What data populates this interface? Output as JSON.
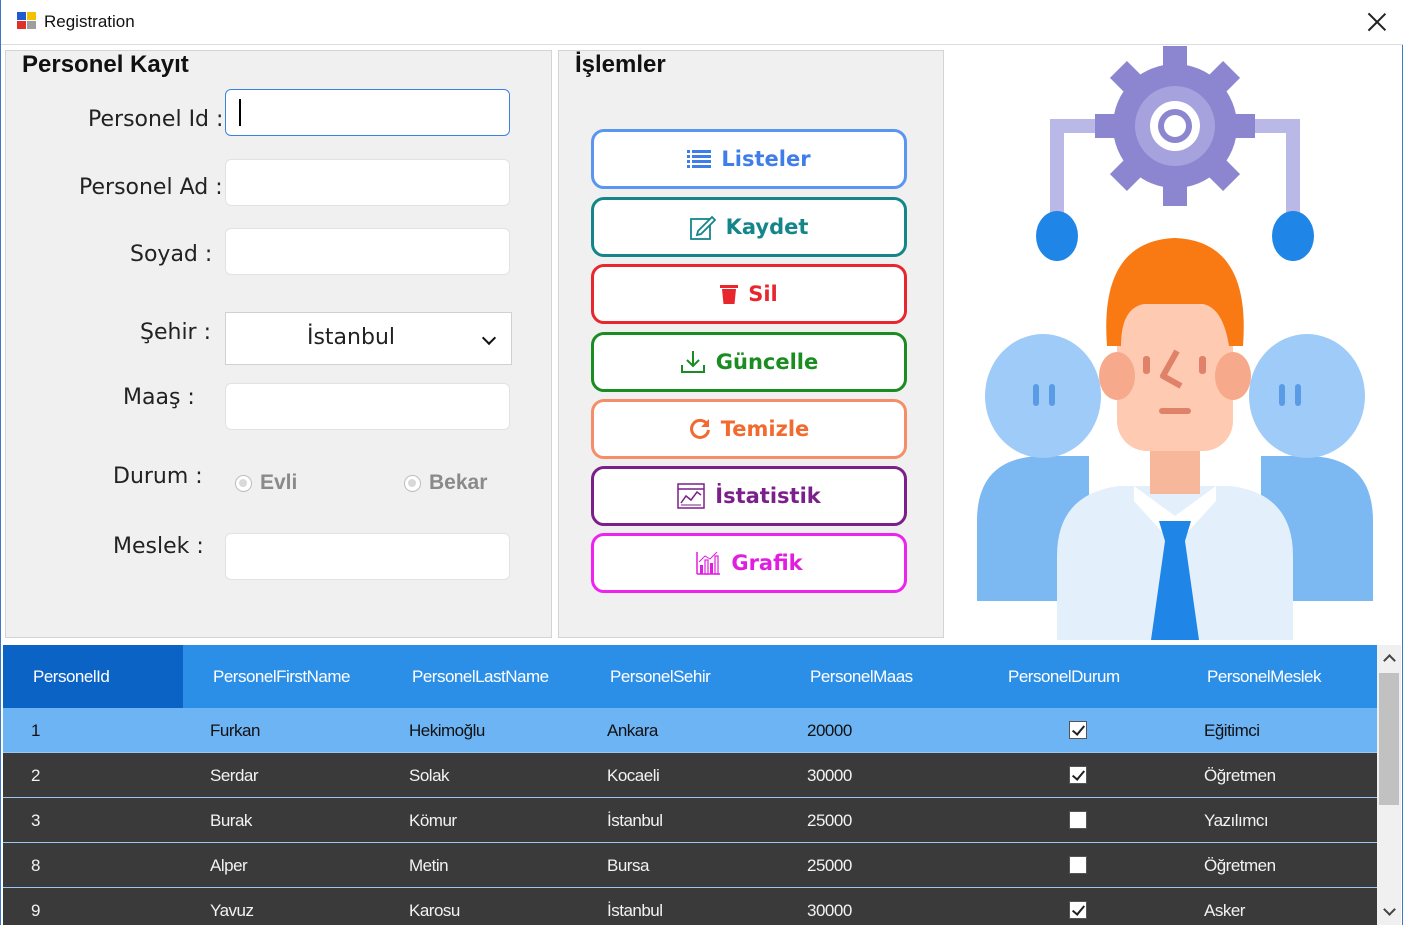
{
  "window": {
    "title": "Registration"
  },
  "personel_group": {
    "title": "Personel Kayıt",
    "labels": {
      "id": "Personel Id :",
      "ad": "Personel Ad :",
      "soyad": "Soyad :",
      "sehir": "Şehir :",
      "maas": "Maaş :",
      "durum": "Durum :",
      "meslek": "Meslek :"
    },
    "fields": {
      "id": "",
      "ad": "",
      "soyad": "",
      "maas": "",
      "meslek": ""
    },
    "sehir_selected": "İstanbul",
    "durum_options": [
      "Evli",
      "Bekar"
    ]
  },
  "islemler_group": {
    "title": "İşlemler",
    "buttons": {
      "listeler": "Listeler",
      "kaydet": "Kaydet",
      "sil": "Sil",
      "guncelle": "Güncelle",
      "temizle": "Temizle",
      "istatistik": "İstatistik",
      "grafik": "Grafik"
    }
  },
  "grid": {
    "columns": [
      "PersonelId",
      "PersonelFirstName",
      "PersonelLastName",
      "PersonelSehir",
      "PersonelMaas",
      "PersonelDurum",
      "PersonelMeslek"
    ],
    "rows": [
      {
        "id": "1",
        "first": "Furkan",
        "last": "Hekimoğlu",
        "sehir": "Ankara",
        "maas": "20000",
        "durum": true,
        "meslek": "Eğitimci"
      },
      {
        "id": "2",
        "first": "Serdar",
        "last": "Solak",
        "sehir": "Kocaeli",
        "maas": "30000",
        "durum": true,
        "meslek": "Öğretmen"
      },
      {
        "id": "3",
        "first": "Burak",
        "last": "Kömur",
        "sehir": "İstanbul",
        "maas": "25000",
        "durum": false,
        "meslek": "Yazılımcı"
      },
      {
        "id": "8",
        "first": "Alper",
        "last": "Metin",
        "sehir": "Bursa",
        "maas": "25000",
        "durum": false,
        "meslek": "Öğretmen"
      },
      {
        "id": "9",
        "first": "Yavuz",
        "last": "Karosu",
        "sehir": "İstanbul",
        "maas": "30000",
        "durum": true,
        "meslek": "Asker"
      }
    ],
    "selected_row_index": 0
  },
  "colors": {
    "grid_header": "#2b8fe8",
    "grid_selected_row": "#6db4f5",
    "grid_row": "#3a3a3a",
    "listeler": "#3f7ee8",
    "kaydet": "#14868a",
    "sil": "#e8262e",
    "guncelle": "#1a8c22",
    "temizle": "#f26a2e",
    "istatistik": "#7b1f8a",
    "grafik": "#e01ee0"
  },
  "icons": {
    "app": "app-icon",
    "close": "close-icon",
    "listeler": "list-icon",
    "kaydet": "edit-icon",
    "sil": "trash-icon",
    "guncelle": "download-icon",
    "temizle": "refresh-icon",
    "istatistik": "stats-icon",
    "grafik": "bar-chart-icon",
    "illustration": "team-management-illustration"
  }
}
